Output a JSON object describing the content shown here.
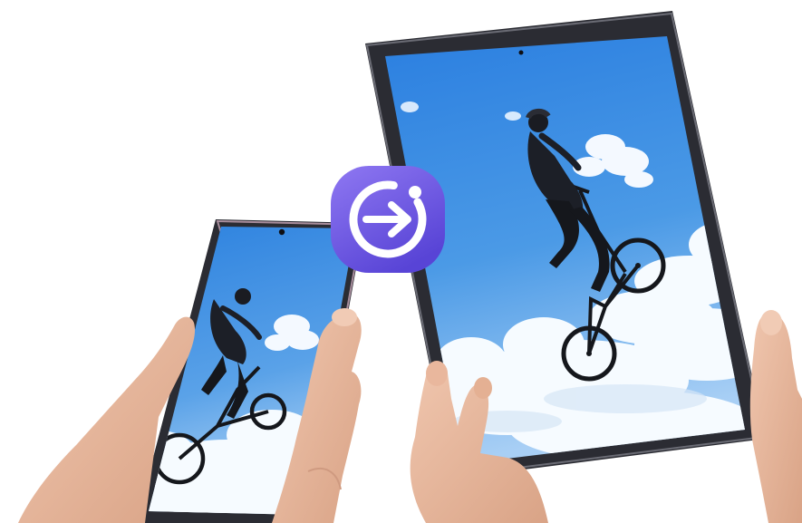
{
  "scene": {
    "subject": "bmx-rider-jump",
    "icons": {
      "transfer": "continue-apps-icon",
      "arrow": "arrow-right-icon"
    },
    "colors": {
      "background": "#ffffff",
      "sky_top": "#2f86e0",
      "sky_bottom": "#a9d0f5",
      "cloud": "#f7fbff",
      "device_frame": "#2a2b33",
      "device_bezel": "#0e0f14",
      "icon_top": "#8c74f0",
      "icon_bottom": "#5b45d8",
      "skin": "#e7b9a0",
      "rider": "#1a1c22"
    }
  }
}
